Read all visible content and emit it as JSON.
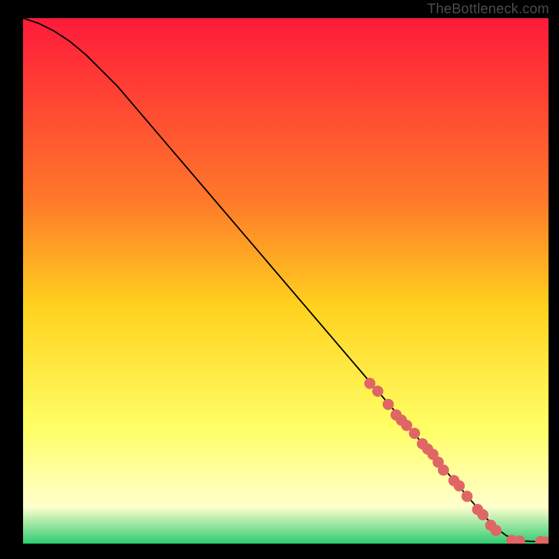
{
  "watermark": "TheBottleneck.com",
  "colors": {
    "bg": "#000000",
    "curve": "#000000",
    "marker": "#e06666",
    "grad_top": "#ff1a3a",
    "grad_mid1": "#ff7a2a",
    "grad_mid2": "#ffd21e",
    "grad_mid3": "#ffff66",
    "grad_mid4": "#ffffcc",
    "grad_bottom": "#2ecc71"
  },
  "chart_data": {
    "type": "line",
    "title": "",
    "xlabel": "",
    "ylabel": "",
    "xlim": [
      0,
      100
    ],
    "ylim": [
      0,
      100
    ],
    "series": [
      {
        "name": "curve",
        "x": [
          0,
          3,
          6,
          9,
          12,
          15,
          18,
          88,
          90,
          92,
          95,
          100
        ],
        "y": [
          100,
          99,
          97.5,
          95.5,
          93,
          90,
          87,
          5,
          3,
          1.5,
          0.5,
          0.3
        ]
      }
    ],
    "markers": {
      "name": "highlight-points",
      "x": [
        66,
        67.5,
        69.5,
        71,
        72,
        73,
        74.5,
        76,
        77,
        78,
        79,
        80,
        82,
        83,
        84.5,
        86.5,
        87.5,
        89,
        90,
        93,
        94.5,
        98.5,
        99.5
      ],
      "y": [
        30.5,
        29,
        26.5,
        24.5,
        23.5,
        22.5,
        21,
        19,
        18,
        17,
        15.5,
        14,
        12,
        11,
        9,
        6.5,
        5.5,
        3.5,
        2.5,
        0.6,
        0.5,
        0.4,
        0.3
      ]
    }
  }
}
